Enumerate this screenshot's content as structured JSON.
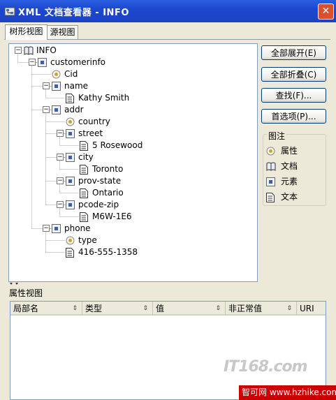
{
  "window": {
    "title": "XML 文档查看器 - INFO",
    "close": "✕"
  },
  "tabs": [
    {
      "label": "树形视图",
      "active": true
    },
    {
      "label": "源视图",
      "active": false
    }
  ],
  "tree": [
    {
      "label": "INFO",
      "type": "document",
      "depth": 0,
      "expander": "−"
    },
    {
      "label": "customerinfo",
      "type": "element",
      "depth": 1,
      "expander": "−"
    },
    {
      "label": "Cid",
      "type": "attribute",
      "depth": 2,
      "expander": ""
    },
    {
      "label": "name",
      "type": "element",
      "depth": 2,
      "expander": "−"
    },
    {
      "label": "Kathy Smith",
      "type": "text",
      "depth": 3,
      "expander": ""
    },
    {
      "label": "addr",
      "type": "element",
      "depth": 2,
      "expander": "−"
    },
    {
      "label": "country",
      "type": "attribute",
      "depth": 3,
      "expander": ""
    },
    {
      "label": "street",
      "type": "element",
      "depth": 3,
      "expander": "−"
    },
    {
      "label": "5 Rosewood",
      "type": "text",
      "depth": 4,
      "expander": ""
    },
    {
      "label": "city",
      "type": "element",
      "depth": 3,
      "expander": "−"
    },
    {
      "label": "Toronto",
      "type": "text",
      "depth": 4,
      "expander": ""
    },
    {
      "label": "prov-state",
      "type": "element",
      "depth": 3,
      "expander": "−"
    },
    {
      "label": "Ontario",
      "type": "text",
      "depth": 4,
      "expander": ""
    },
    {
      "label": "pcode-zip",
      "type": "element",
      "depth": 3,
      "expander": "−"
    },
    {
      "label": "M6W-1E6",
      "type": "text",
      "depth": 4,
      "expander": ""
    },
    {
      "label": "phone",
      "type": "element",
      "depth": 2,
      "expander": "−"
    },
    {
      "label": "type",
      "type": "attribute",
      "depth": 3,
      "expander": ""
    },
    {
      "label": "416-555-1358",
      "type": "text",
      "depth": 3,
      "expander": ""
    }
  ],
  "buttons": {
    "expand_all": "全部展开(E)",
    "collapse_all": "全部折叠(C)",
    "find": "查找(F)...",
    "preferences": "首选项(P)..."
  },
  "legend": {
    "title": "图注",
    "items": [
      {
        "icon": "attribute-icon",
        "label": "属性"
      },
      {
        "icon": "document-icon",
        "label": "文档"
      },
      {
        "icon": "element-icon",
        "label": "元素"
      },
      {
        "icon": "text-icon",
        "label": "文本"
      }
    ]
  },
  "attributes": {
    "title": "属性视图",
    "columns": [
      {
        "label": "局部名",
        "sort": "⇕"
      },
      {
        "label": "类型",
        "sort": "⇕"
      },
      {
        "label": "值",
        "sort": "⇕"
      },
      {
        "label": "非正常值",
        "sort": "⇕"
      },
      {
        "label": "URI",
        "sort": ""
      }
    ]
  },
  "watermark": {
    "logo": "IT168.com",
    "site": "智可网 www.hzhike.com"
  },
  "colors": {
    "titlebar": "#1b48cf",
    "close": "#d9502c",
    "watermark_bar": "#cc0000"
  }
}
